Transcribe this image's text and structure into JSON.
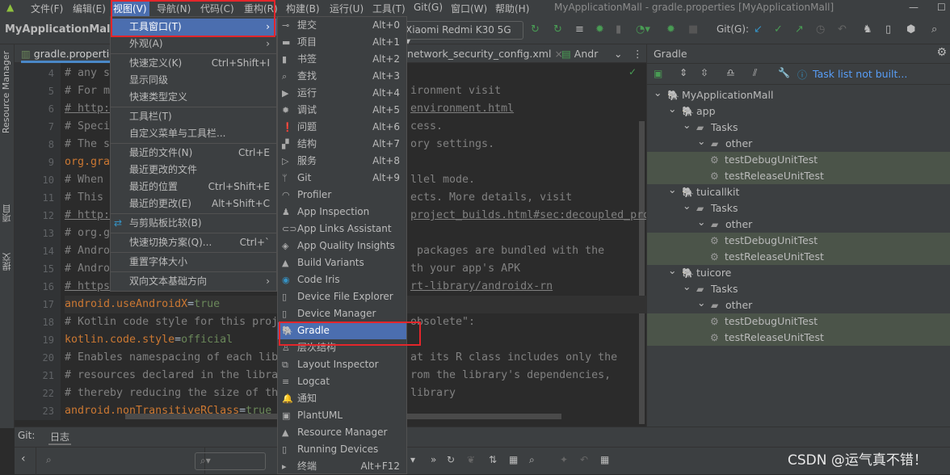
{
  "menubar": {
    "items": [
      "文件(F)",
      "编辑(E)",
      "视图(V)",
      "导航(N)",
      "代码(C)",
      "重构(R)",
      "构建(B)",
      "运行(U)",
      "工具(T)",
      "Git(G)",
      "窗口(W)",
      "帮助(H)"
    ],
    "title": "MyApplicationMall - gradle.properties [MyApplicationMall]"
  },
  "toolbar": {
    "breadcrumb": "MyApplicationMall",
    "device": "Xiaomi Redmi K30 5G",
    "git_label": "Git(G):"
  },
  "left_strip": {
    "labels": [
      "Resource Manager",
      "项目",
      "提交"
    ]
  },
  "tabs": [
    {
      "label": "gradle.properties"
    },
    {
      "label": "network_security_config.xml"
    },
    {
      "label": "Andr"
    }
  ],
  "editor": {
    "lines": [
      {
        "n": "4",
        "l": "# any s",
        "r": "",
        "t": "cm"
      },
      {
        "n": "5",
        "l": "# For m",
        "r": "ironment visit",
        "t": "cm"
      },
      {
        "n": "6",
        "l": "# http:",
        "r": "environment.html",
        "t": "lk"
      },
      {
        "n": "7",
        "l": "# Speci",
        "r": "cess.",
        "t": "cm"
      },
      {
        "n": "8",
        "l": "# The s",
        "r": "ory settings.",
        "t": "cm"
      },
      {
        "n": "9",
        "l": "org.gra",
        "r": "",
        "t": "ky"
      },
      {
        "n": "10",
        "l": "# When ",
        "r": "llel mode.",
        "t": "cm"
      },
      {
        "n": "11",
        "l": "# This ",
        "r": "ects. More details, visit",
        "t": "cm"
      },
      {
        "n": "12",
        "l": "# http:",
        "r": "project_builds.html#sec:decoupled_pro",
        "t": "lk"
      },
      {
        "n": "13",
        "l": "# org.g",
        "r": "",
        "t": "cm"
      },
      {
        "n": "14",
        "l": "# Andro",
        "r": " packages are bundled with the",
        "t": "cm"
      },
      {
        "n": "15",
        "l": "# Andro",
        "r": "th your app's APK",
        "t": "cm"
      },
      {
        "n": "16",
        "l": "# https",
        "r": "rt-library/androidx-rn",
        "t": "lk"
      },
      {
        "n": "17",
        "k": "android.useAndroidX",
        "v": "true",
        "t": "kv"
      },
      {
        "n": "18",
        "l": "# Kotlin code style for this proj",
        "r": "obsolete\":",
        "t": "cm"
      },
      {
        "n": "19",
        "k": "kotlin.code.style",
        "v": "official",
        "t": "kv"
      },
      {
        "n": "20",
        "l": "# Enables namespacing of each lib",
        "r": "at its R class includes only the",
        "t": "cm"
      },
      {
        "n": "21",
        "l": "# resources declared in the libra",
        "r": "rom the library's dependencies,",
        "t": "cm"
      },
      {
        "n": "22",
        "l": "# thereby reducing the size of th",
        "r": "library",
        "t": "cm"
      },
      {
        "n": "23",
        "k": "android.nonTransitiveRClass",
        "v": "true",
        "t": "kv"
      }
    ]
  },
  "gradle_panel": {
    "title": "Gradle",
    "status": "Task list not built...",
    "tree": [
      {
        "label": "MyApplicationMall",
        "depth": 0,
        "icon": "elephant"
      },
      {
        "label": "app",
        "depth": 1,
        "icon": "elephant"
      },
      {
        "label": "Tasks",
        "depth": 2,
        "icon": "folder-gear"
      },
      {
        "label": "other",
        "depth": 3,
        "icon": "folder-gear"
      },
      {
        "label": "testDebugUnitTest",
        "depth": 4,
        "icon": "gear",
        "sel": true
      },
      {
        "label": "testReleaseUnitTest",
        "depth": 4,
        "icon": "gear",
        "sel": true
      },
      {
        "label": "tuicallkit",
        "depth": 1,
        "icon": "elephant"
      },
      {
        "label": "Tasks",
        "depth": 2,
        "icon": "folder-gear"
      },
      {
        "label": "other",
        "depth": 3,
        "icon": "folder-gear"
      },
      {
        "label": "testDebugUnitTest",
        "depth": 4,
        "icon": "gear",
        "sel": true
      },
      {
        "label": "testReleaseUnitTest",
        "depth": 4,
        "icon": "gear",
        "sel": true
      },
      {
        "label": "tuicore",
        "depth": 1,
        "icon": "elephant"
      },
      {
        "label": "Tasks",
        "depth": 2,
        "icon": "folder-gear"
      },
      {
        "label": "other",
        "depth": 3,
        "icon": "folder-gear"
      },
      {
        "label": "testDebugUnitTest",
        "depth": 4,
        "icon": "gear",
        "sel": true
      },
      {
        "label": "testReleaseUnitTest",
        "depth": 4,
        "icon": "gear",
        "sel": true
      }
    ]
  },
  "bottom": {
    "git_label": "Git:",
    "tab": "日志"
  },
  "view_menu": {
    "items": [
      {
        "label": "工具窗口(T)",
        "sub": true,
        "hl": true
      },
      {
        "label": "外观(A)",
        "sub": true,
        "sep": true
      },
      {
        "label": "快速定义(K)",
        "sc": "Ctrl+Shift+I"
      },
      {
        "label": "显示同级"
      },
      {
        "label": "快速类型定义",
        "sep": true
      },
      {
        "label": "工具栏(T)"
      },
      {
        "label": "自定义菜单与工具栏...",
        "sep": true
      },
      {
        "label": "最近的文件(N)",
        "sc": "Ctrl+E"
      },
      {
        "label": "最近更改的文件"
      },
      {
        "label": "最近的位置",
        "sc": "Ctrl+Shift+E"
      },
      {
        "label": "最近的更改(E)",
        "sc": "Alt+Shift+C",
        "sep": true
      },
      {
        "label": "与剪贴板比较(B)",
        "icon": "clipboard-compare",
        "sep": true
      },
      {
        "label": "快速切换方案(Q)...",
        "sc": "Ctrl+`",
        "sep": true
      },
      {
        "label": "重置字体大小",
        "sep": true
      },
      {
        "label": "双向文本基础方向",
        "sub": true
      }
    ]
  },
  "tool_windows": {
    "items": [
      {
        "label": "提交",
        "sc": "Alt+0",
        "icon": "commit"
      },
      {
        "label": "项目",
        "sc": "Alt+1",
        "icon": "folder"
      },
      {
        "label": "书签",
        "sc": "Alt+2",
        "icon": "bookmark"
      },
      {
        "label": "查找",
        "sc": "Alt+3",
        "icon": "search"
      },
      {
        "label": "运行",
        "sc": "Alt+4",
        "icon": "play"
      },
      {
        "label": "调试",
        "sc": "Alt+5",
        "icon": "bug"
      },
      {
        "label": "问题",
        "sc": "Alt+6",
        "icon": "warning"
      },
      {
        "label": "结构",
        "sc": "Alt+7",
        "icon": "structure"
      },
      {
        "label": "服务",
        "sc": "Alt+8",
        "icon": "services"
      },
      {
        "label": "Git",
        "sc": "Alt+9",
        "icon": "git"
      },
      {
        "label": "Profiler",
        "icon": "profiler"
      },
      {
        "label": "App Inspection",
        "icon": "inspection"
      },
      {
        "label": "App Links Assistant",
        "icon": "link"
      },
      {
        "label": "App Quality Insights",
        "icon": "diamond"
      },
      {
        "label": "Build Variants",
        "icon": "android"
      },
      {
        "label": "Code Iris",
        "icon": "eye"
      },
      {
        "label": "Device File Explorer",
        "icon": "phone"
      },
      {
        "label": "Device Manager",
        "icon": "devices"
      },
      {
        "label": "Gradle",
        "icon": "elephant",
        "hl": true
      },
      {
        "label": "层次结构",
        "icon": "hierarchy"
      },
      {
        "label": "Layout Inspector",
        "icon": "layout-inspector"
      },
      {
        "label": "Logcat",
        "icon": "logcat"
      },
      {
        "label": "通知",
        "icon": "bell"
      },
      {
        "label": "PlantUML",
        "icon": "plantuml"
      },
      {
        "label": "Resource Manager",
        "icon": "resources"
      },
      {
        "label": "Running Devices",
        "icon": "running-devices"
      },
      {
        "label": "终端",
        "sc": "Alt+F12",
        "icon": "terminal"
      }
    ]
  },
  "watermark": "CSDN @运气真不错！",
  "colors": {
    "highlight": "#4b6eaf",
    "annotation_box": "#e3262b",
    "menu_bg": "#3c3f41",
    "editor_bg": "#2b2b2b"
  }
}
